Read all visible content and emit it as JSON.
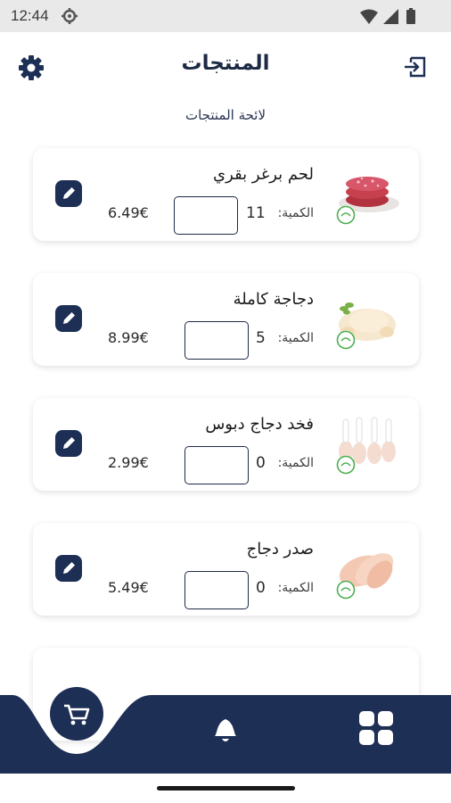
{
  "status_bar": {
    "time": "12:44"
  },
  "header": {
    "title": "المنتجات"
  },
  "subtitle": "لائحة المنتجات",
  "products": [
    {
      "name": "لحم برغر بقري",
      "quantity_label": "الكمية:",
      "quantity": "11",
      "price": "6.49€",
      "image_icon": "beef-burger-image"
    },
    {
      "name": "دجاجة كاملة",
      "quantity_label": "الكمية:",
      "quantity": "5",
      "price": "8.99€",
      "image_icon": "whole-chicken-image"
    },
    {
      "name": "فخد دجاج دبوس",
      "quantity_label": "الكمية:",
      "quantity": "0",
      "price": "2.99€",
      "image_icon": "chicken-drumsticks-image"
    },
    {
      "name": "صدر دجاج",
      "quantity_label": "الكمية:",
      "quantity": "0",
      "price": "5.49€",
      "image_icon": "chicken-breast-image"
    }
  ],
  "colors": {
    "navy": "#1d2f55",
    "halal_green": "#4caf50"
  }
}
